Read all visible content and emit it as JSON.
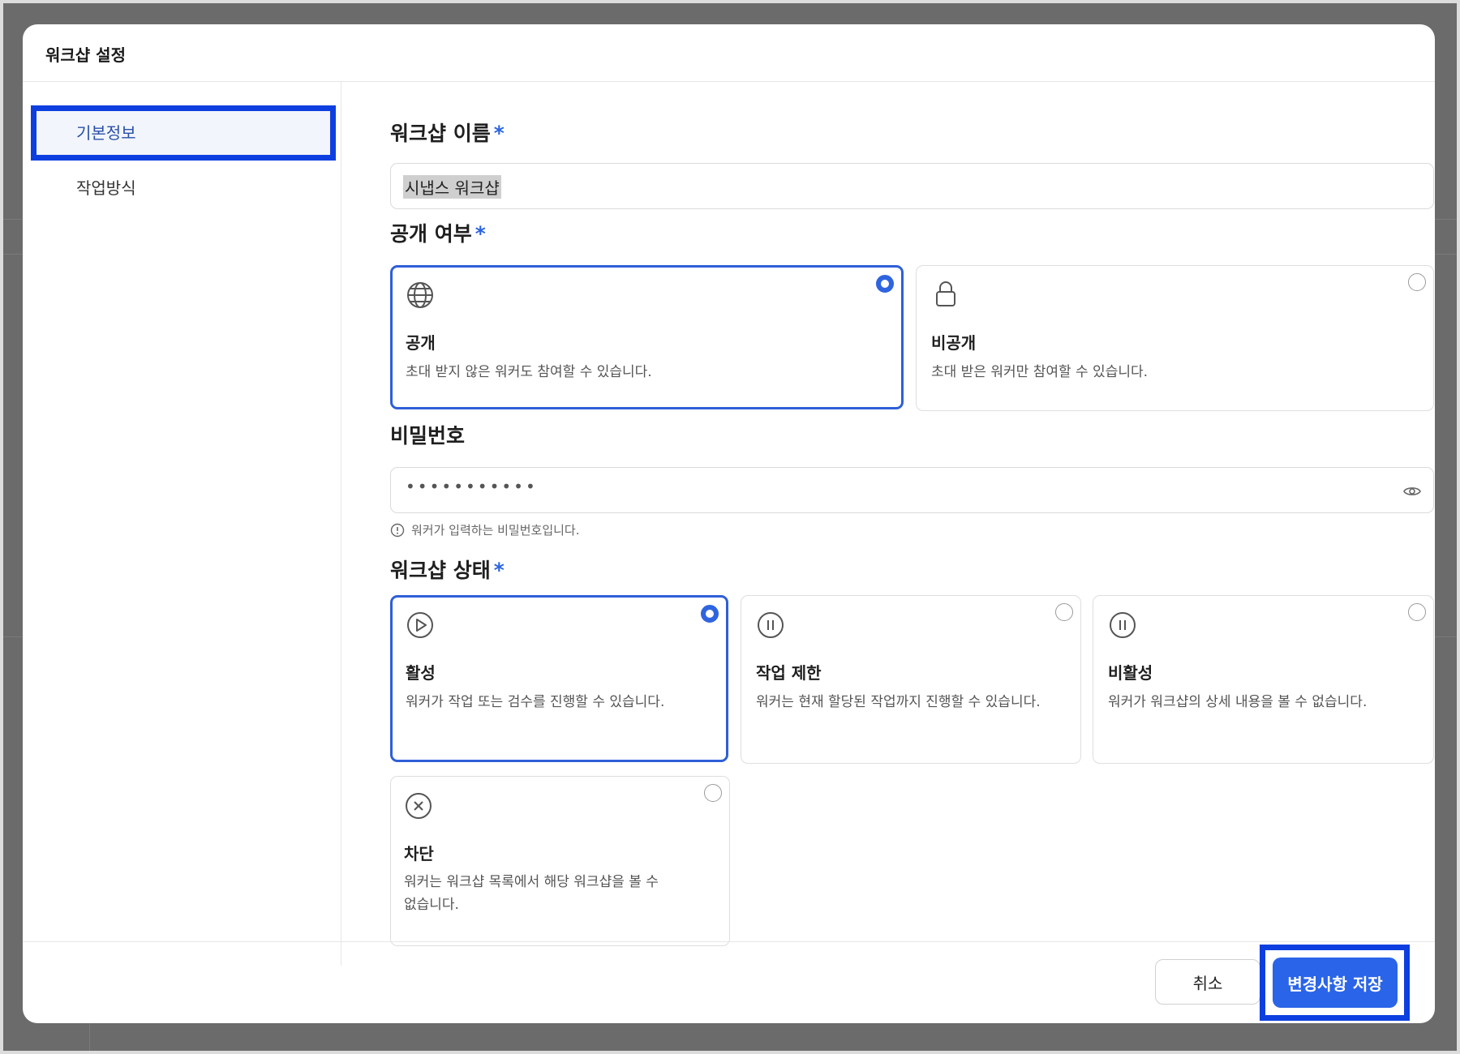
{
  "modal": {
    "title": "워크샵 설정",
    "colors": {
      "accent": "#2a64e8",
      "highlight_box": "#0d3fe0"
    }
  },
  "sidebar": {
    "items": [
      {
        "label": "기본정보",
        "active": true
      },
      {
        "label": "작업방식",
        "active": false
      }
    ]
  },
  "name_section": {
    "label": "워크샵 이름",
    "required_mark": "*",
    "value": "시냅스 워크샵"
  },
  "visibility_section": {
    "label": "공개 여부",
    "required_mark": "*",
    "options": [
      {
        "icon": "globe-icon",
        "title": "공개",
        "desc": "초대 받지 않은 워커도 참여할 수 있습니다.",
        "selected": true
      },
      {
        "icon": "lock-icon",
        "title": "비공개",
        "desc": "초대 받은 워커만 참여할 수 있습니다.",
        "selected": false
      }
    ]
  },
  "password_section": {
    "label": "비밀번호",
    "masked_value": "•••••••••••",
    "help": "워커가 입력하는 비밀번호입니다."
  },
  "status_section": {
    "label": "워크샵 상태",
    "required_mark": "*",
    "options": [
      {
        "icon": "play-circle-icon",
        "title": "활성",
        "desc": "워커가 작업 또는 검수를 진행할 수 있습니다.",
        "selected": true
      },
      {
        "icon": "pause-circle-icon",
        "title": "작업 제한",
        "desc": "워커는 현재 할당된 작업까지 진행할 수 있습니다.",
        "selected": false
      },
      {
        "icon": "pause-circle-icon",
        "title": "비활성",
        "desc": "워커가 워크샵의 상세 내용을 볼 수 없습니다.",
        "selected": false
      },
      {
        "icon": "x-circle-icon",
        "title": "차단",
        "desc_line1": "워커는 워크샵 목록에서 해당 워크샵을 볼 수",
        "desc_line2": "없습니다.",
        "selected": false
      }
    ]
  },
  "footer": {
    "cancel_label": "취소",
    "save_label": "변경사항 저장"
  }
}
